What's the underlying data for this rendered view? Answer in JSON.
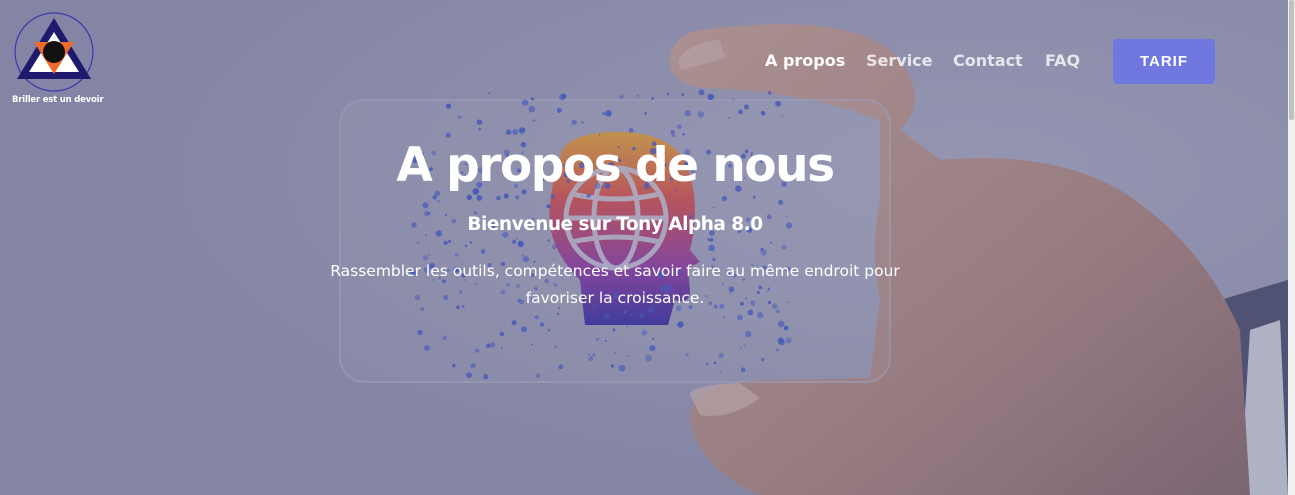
{
  "brand": {
    "tagline": "Briller est un devoir"
  },
  "nav": {
    "links": [
      {
        "label": "A propos",
        "active": true
      },
      {
        "label": "Service",
        "active": false
      },
      {
        "label": "Contact",
        "active": false
      },
      {
        "label": "FAQ",
        "active": false
      }
    ],
    "cta_label": "TARIF"
  },
  "hero": {
    "title": "A propos de nous",
    "subtitle": "Bienvenue sur Tony Alpha 8.0",
    "text": "Rassembler les outils, compétences et savoir faire au même endroit pour favoriser la croissance."
  },
  "colors": {
    "accent": "#6e78de",
    "overlay": "#8d8da8",
    "logo_dark": "#1e1a6e",
    "logo_orange": "#f06a2a"
  }
}
